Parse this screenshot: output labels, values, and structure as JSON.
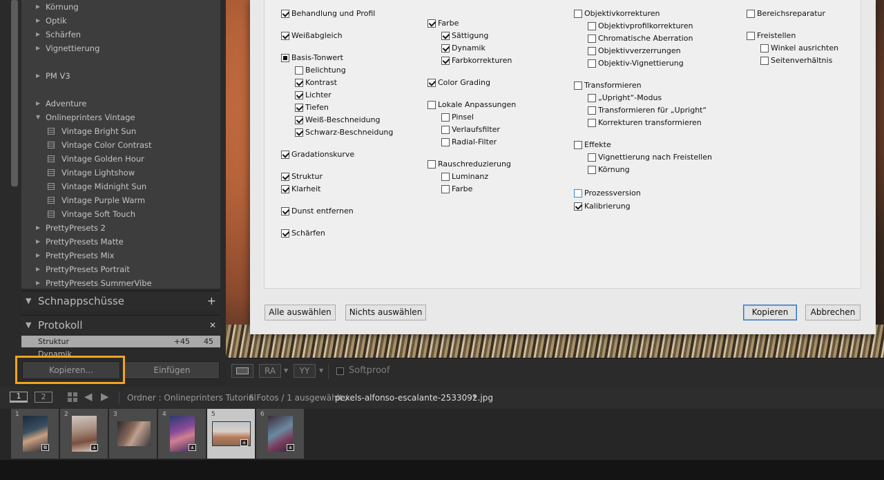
{
  "presets": {
    "groups_top": [
      "Körnung",
      "Optik",
      "Schärfen",
      "Vignettierung"
    ],
    "pm": "PM V3",
    "adventure": "Adventure",
    "vintage_group": "Onlineprinters Vintage",
    "vintage_items": [
      "Vintage Bright Sun",
      "Vintage Color Contrast",
      "Vintage Golden Hour",
      "Vintage Lightshow",
      "Vintage Midnight Sun",
      "Vintage Purple Warm",
      "Vintage Soft Touch"
    ],
    "pretty": [
      "PrettyPresets 2",
      "PrettyPresets Matte",
      "PrettyPresets Mix",
      "PrettyPresets Portrait",
      "PrettyPresets SummerVibe"
    ]
  },
  "panels": {
    "snapshots": "Schnappschüsse",
    "history": "Protokoll",
    "add_symbol": "+",
    "close_symbol": "✕"
  },
  "history": [
    {
      "name": "Struktur",
      "a": "+45",
      "b": "45"
    },
    {
      "name": "Dynamik",
      "a": "",
      "b": ""
    }
  ],
  "left_buttons": {
    "copy": "Kopieren...",
    "paste": "Einfügen"
  },
  "dialog": {
    "col1": [
      {
        "t": "Behandlung und Profil",
        "s": "on"
      },
      {
        "t": "Weißabgleich",
        "s": "on"
      },
      {
        "t": "Basis-Tonwert",
        "s": "mixed"
      },
      {
        "t": "Belichtung",
        "s": "off"
      },
      {
        "t": "Kontrast",
        "s": "on"
      },
      {
        "t": "Lichter",
        "s": "on"
      },
      {
        "t": "Tiefen",
        "s": "on"
      },
      {
        "t": "Weiß-Beschneidung",
        "s": "on"
      },
      {
        "t": "Schwarz-Beschneidung",
        "s": "on"
      },
      {
        "t": "Gradationskurve",
        "s": "on"
      },
      {
        "t": "Struktur",
        "s": "on"
      },
      {
        "t": "Klarheit",
        "s": "on"
      },
      {
        "t": "Dunst entfernen",
        "s": "on"
      },
      {
        "t": "Schärfen",
        "s": "on"
      }
    ],
    "col2": [
      {
        "t": "Farbe",
        "s": "on"
      },
      {
        "t": "Sättigung",
        "s": "on"
      },
      {
        "t": "Dynamik",
        "s": "on"
      },
      {
        "t": "Farbkorrekturen",
        "s": "on"
      },
      {
        "t": "Color Grading",
        "s": "on"
      },
      {
        "t": "Lokale Anpassungen",
        "s": "off"
      },
      {
        "t": "Pinsel",
        "s": "off"
      },
      {
        "t": "Verlaufsfilter",
        "s": "off"
      },
      {
        "t": "Radial-Filter",
        "s": "off"
      },
      {
        "t": "Rauschreduzierung",
        "s": "off"
      },
      {
        "t": "Luminanz",
        "s": "off"
      },
      {
        "t": "Farbe",
        "s": "off"
      }
    ],
    "col3": [
      {
        "t": "Objektivkorrekturen",
        "s": "off"
      },
      {
        "t": "Objektivprofilkorrekturen",
        "s": "off"
      },
      {
        "t": "Chromatische Aberration",
        "s": "off"
      },
      {
        "t": "Objektivverzerrungen",
        "s": "off"
      },
      {
        "t": "Objektiv-Vignettierung",
        "s": "off"
      },
      {
        "t": "Transformieren",
        "s": "off"
      },
      {
        "t": "„Upright“-Modus",
        "s": "off"
      },
      {
        "t": "Transformieren für „Upright“",
        "s": "off"
      },
      {
        "t": "Korrekturen transformieren",
        "s": "off"
      },
      {
        "t": "Effekte",
        "s": "off"
      },
      {
        "t": "Vignettierung nach Freistellen",
        "s": "off"
      },
      {
        "t": "Körnung",
        "s": "off"
      },
      {
        "t": "Prozessversion",
        "s": "blue"
      },
      {
        "t": "Kalibrierung",
        "s": "on"
      }
    ],
    "col4": [
      {
        "t": "Bereichsreparatur",
        "s": "off"
      },
      {
        "t": "Freistellen",
        "s": "off"
      },
      {
        "t": "Winkel ausrichten",
        "s": "off"
      },
      {
        "t": "Seitenverhältnis",
        "s": "off"
      }
    ],
    "buttons": {
      "select_all": "Alle auswählen",
      "select_none": "Nichts auswählen",
      "copy": "Kopieren",
      "cancel": "Abbrechen"
    }
  },
  "toolbar": {
    "softproof": "Softproof",
    "ra": "RA",
    "yy": "YY"
  },
  "filmstrip_header": {
    "view1": "1",
    "view2": "2",
    "folder": "Ordner : Onlineprinters Tutorial",
    "count": "6 Fotos / 1 ausgewählt /",
    "filename": "pexels-alfonso-escalante-2533092.jpg"
  },
  "thumbs": [
    "1",
    "2",
    "3",
    "4",
    "5",
    "6"
  ],
  "selected_thumb": "5"
}
